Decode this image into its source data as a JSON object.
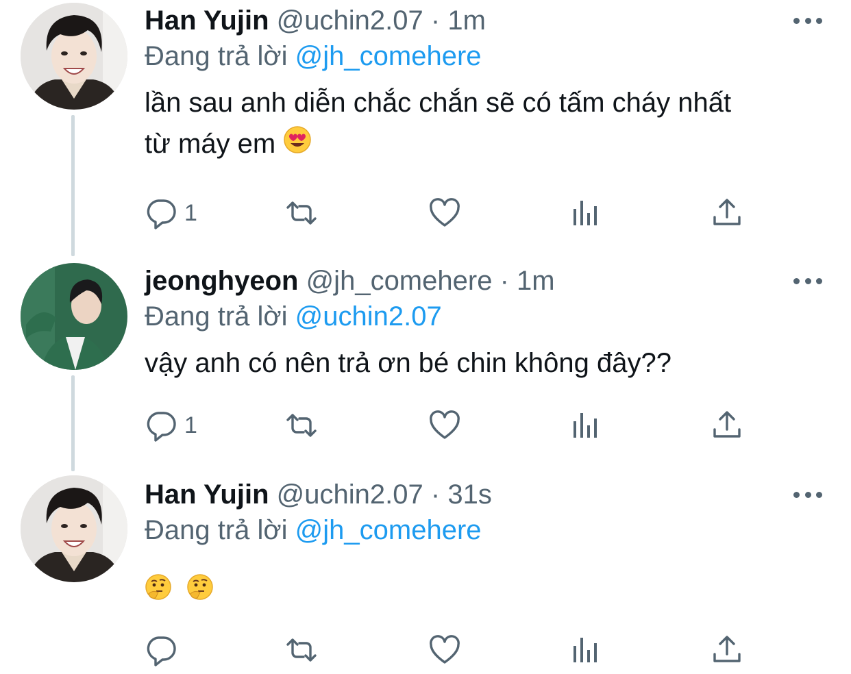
{
  "colors": {
    "text": "#0f1419",
    "secondary": "#536471",
    "link": "#1d9bf0",
    "thread_line": "#cfd9de"
  },
  "tweets": [
    {
      "name": "Han Yujin",
      "handle": "@uchin2.07",
      "separator": "·",
      "time": "1m",
      "replying_prefix": "Đang trả lời",
      "replying_to": "@jh_comehere",
      "text_line1": "lần sau anh diễn chắc chắn sẽ có tấm cháy nhất",
      "text_line2": "từ máy em",
      "emoji": "heart-eyes-emoji",
      "reply_count": "1",
      "avatar": "avatar-han-yujin"
    },
    {
      "name": "jeonghyeon",
      "handle": "@jh_comehere",
      "separator": "·",
      "time": "1m",
      "replying_prefix": "Đang trả lời",
      "replying_to": "@uchin2.07",
      "text_line1": "vậy anh có nên trả ơn bé chin không đây??",
      "reply_count": "1",
      "avatar": "avatar-jeonghyeon"
    },
    {
      "name": "Han Yujin",
      "handle": "@uchin2.07",
      "separator": "·",
      "time": "31s",
      "replying_prefix": "Đang trả lời",
      "replying_to": "@jh_comehere",
      "emojis": [
        "thinking-face-emoji",
        "thinking-face-emoji"
      ],
      "reply_count": "",
      "avatar": "avatar-han-yujin"
    }
  ],
  "icons": {
    "reply": "reply-icon",
    "retweet": "retweet-icon",
    "like": "heart-icon",
    "analytics": "analytics-icon",
    "share": "share-icon",
    "more": "more-options-icon"
  }
}
